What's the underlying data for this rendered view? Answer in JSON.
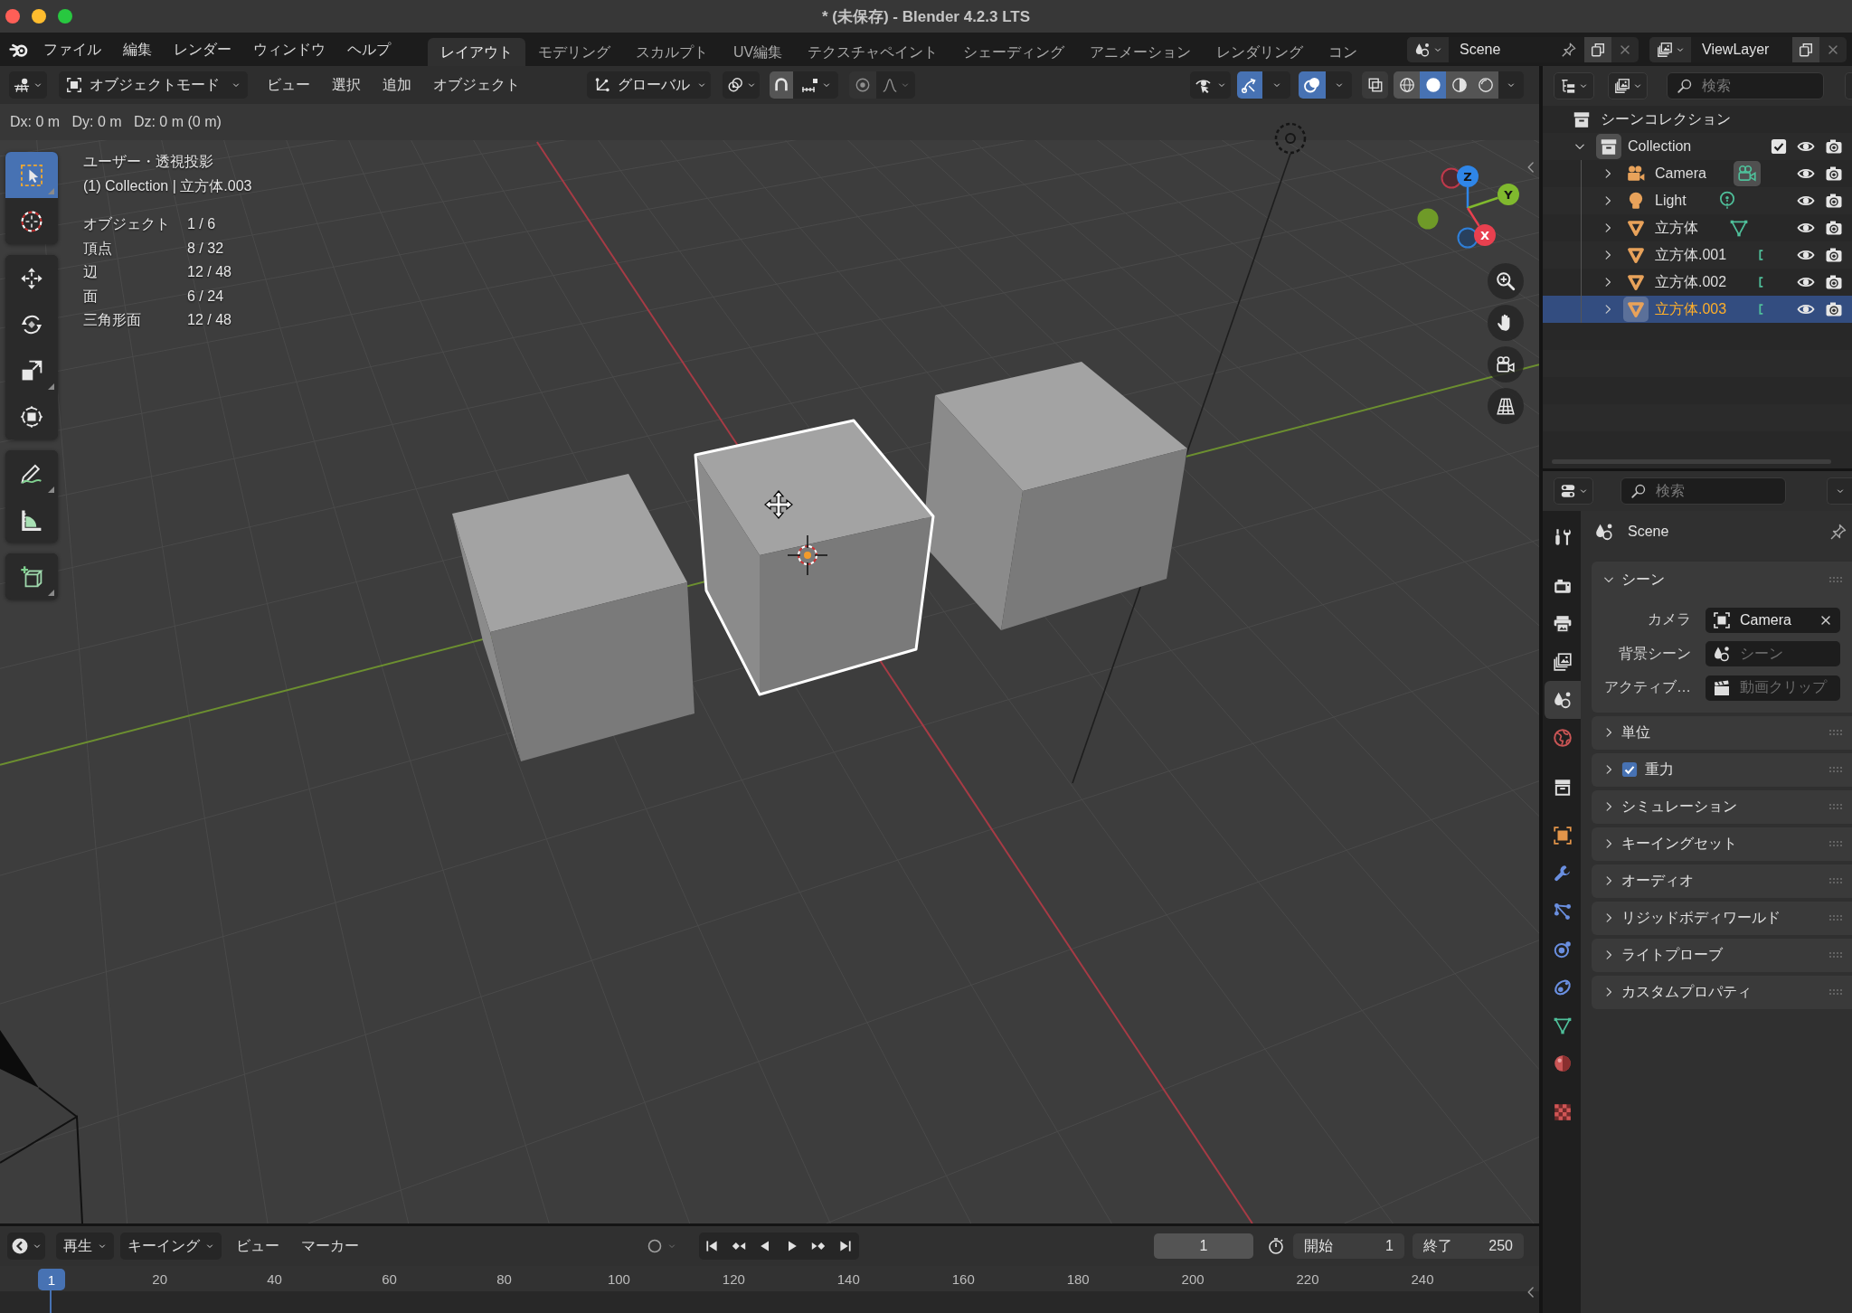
{
  "window": {
    "title": "* (未保存) - Blender 4.2.3 LTS"
  },
  "top_bar": {
    "menus": [
      "ファイル",
      "編集",
      "レンダー",
      "ウィンドウ",
      "ヘルプ"
    ],
    "workspace_tabs": [
      {
        "label": "レイアウト",
        "selected": true
      },
      {
        "label": "モデリング",
        "selected": false
      },
      {
        "label": "スカルプト",
        "selected": false
      },
      {
        "label": "UV編集",
        "selected": false
      },
      {
        "label": "テクスチャペイント",
        "selected": false
      },
      {
        "label": "シェーディング",
        "selected": false
      },
      {
        "label": "アニメーション",
        "selected": false
      },
      {
        "label": "レンダリング",
        "selected": false
      },
      {
        "label": "コン",
        "selected": false
      }
    ],
    "scene": {
      "value": "Scene"
    },
    "view_layer": {
      "value": "ViewLayer"
    }
  },
  "viewport": {
    "header": {
      "mode": "オブジェクトモード",
      "menus": [
        "ビュー",
        "選択",
        "追加",
        "オブジェクト"
      ],
      "orientation": "グローバル",
      "show_gizmos": true,
      "show_overlays": true,
      "xray": false,
      "shading_modes": [
        {
          "selected": false
        },
        {
          "selected": true
        },
        {
          "selected": false
        },
        {
          "selected": false
        }
      ]
    },
    "status": "Dx: 0 m   Dy: 0 m   Dz: 0 m (0 m)",
    "tool_groups": [
      [
        {
          "selected": true,
          "submenu": true
        },
        {
          "selected": false,
          "submenu": false
        }
      ],
      [
        {
          "selected": false,
          "submenu": false
        },
        {
          "selected": false,
          "submenu": false
        },
        {
          "selected": false,
          "submenu": true
        },
        {
          "selected": false,
          "submenu": false
        }
      ],
      [
        {
          "selected": false,
          "submenu": true
        },
        {
          "selected": false,
          "submenu": false
        }
      ],
      [
        {
          "selected": false,
          "submenu": true
        }
      ]
    ],
    "overlay": {
      "view": "ユーザー・透視投影",
      "context": "(1) Collection | 立方体.003",
      "stats": [
        {
          "label": "オブジェクト",
          "value": "1 / 6"
        },
        {
          "label": "頂点",
          "value": "8 / 32"
        },
        {
          "label": "辺",
          "value": "12 / 48"
        },
        {
          "label": "面",
          "value": "6 / 24"
        },
        {
          "label": "三角形面",
          "value": "12 / 48"
        }
      ]
    },
    "gizmo_labels": [
      "X",
      "Y",
      "Z"
    ],
    "cubes": [
      {
        "selected": false
      },
      {
        "selected": true
      },
      {
        "selected": false
      }
    ]
  },
  "outliner": {
    "search": {
      "placeholder": "検索"
    },
    "tree": {
      "label": "シーンコレクション",
      "selected": false,
      "children": [
        {
          "label": "Collection",
          "expanded": true,
          "checked": true,
          "active": true,
          "selected": false,
          "children": [
            {
              "label": "Camera",
              "kind": "camera",
              "expanded": false,
              "selected": false,
              "data_icon_clipped": false
            },
            {
              "label": "Light",
              "kind": "light",
              "expanded": false,
              "selected": false,
              "data_icon_clipped": false
            },
            {
              "label": "立方体",
              "kind": "mesh",
              "expanded": false,
              "selected": false,
              "data_icon_clipped": false
            },
            {
              "label": "立方体.001",
              "kind": "mesh",
              "expanded": false,
              "selected": false,
              "data_icon_clipped": true
            },
            {
              "label": "立方体.002",
              "kind": "mesh",
              "expanded": false,
              "selected": false,
              "data_icon_clipped": true
            },
            {
              "label": "立方体.003",
              "kind": "mesh",
              "expanded": false,
              "selected": true,
              "data_icon_clipped": true
            }
          ]
        }
      ]
    }
  },
  "properties": {
    "search": {
      "placeholder": "検索"
    },
    "tab_groups": [
      [
        {
          "selected": false
        }
      ],
      [
        {
          "selected": false
        },
        {
          "selected": false
        },
        {
          "selected": false
        },
        {
          "selected": true
        },
        {
          "selected": false
        }
      ],
      [
        {
          "selected": false
        }
      ],
      [
        {
          "selected": false
        },
        {
          "selected": false
        },
        {
          "selected": false
        },
        {
          "selected": false
        },
        {
          "selected": false
        },
        {
          "selected": false
        },
        {
          "selected": false
        }
      ],
      [
        {
          "selected": false
        }
      ]
    ],
    "context": "Scene",
    "panels": [
      {
        "title": "シーン",
        "kind": "plain",
        "expanded": true,
        "fields": [
          {
            "label": "カメラ",
            "kind": "object",
            "value": "Camera"
          },
          {
            "label": "背景シーン",
            "kind": "scene",
            "placeholder": "シーン"
          },
          {
            "label": "アクティブ…",
            "kind": "clip",
            "placeholder": "動画クリップ"
          }
        ]
      },
      {
        "title": "単位",
        "kind": "plain",
        "expanded": false
      },
      {
        "title": "重力",
        "kind": "checkbox",
        "checked": true,
        "expanded": false
      },
      {
        "title": "シミュレーション",
        "kind": "plain",
        "expanded": false
      },
      {
        "title": "キーイングセット",
        "kind": "plain",
        "expanded": false
      },
      {
        "title": "オーディオ",
        "kind": "plain",
        "expanded": false
      },
      {
        "title": "リジッドボディワールド",
        "kind": "plain",
        "expanded": false
      },
      {
        "title": "ライトプローブ",
        "kind": "plain",
        "expanded": false
      },
      {
        "title": "カスタムプロパティ",
        "kind": "plain",
        "expanded": false
      }
    ]
  },
  "timeline": {
    "menus": [
      {
        "label": "再生",
        "kind": "dropdown"
      },
      {
        "label": "キーイング",
        "kind": "dropdown"
      },
      {
        "label": "ビュー",
        "kind": "menu"
      },
      {
        "label": "マーカー",
        "kind": "menu"
      }
    ],
    "auto_keying": false,
    "current_frame": "1",
    "start": {
      "label": "開始",
      "value": "1"
    },
    "end": {
      "label": "終了",
      "value": "250"
    },
    "ruler": {
      "playhead": "1",
      "labels": [
        "20",
        "40",
        "60",
        "80",
        "100",
        "120",
        "140",
        "160",
        "180",
        "200",
        "220",
        "240"
      ]
    }
  }
}
